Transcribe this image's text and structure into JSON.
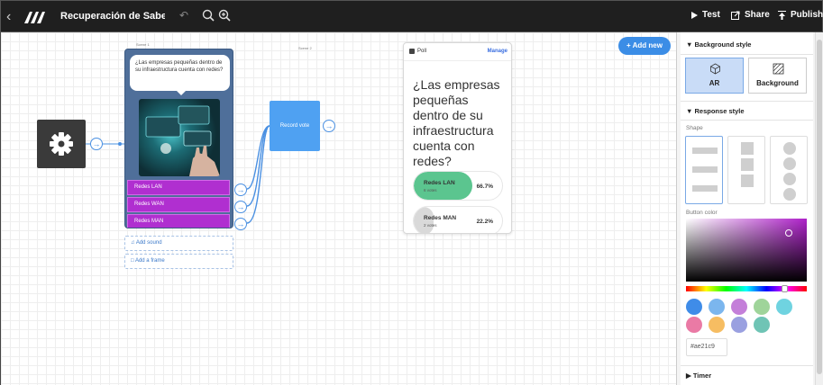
{
  "topbar": {
    "project_title": "Recuperación de Saberes Pı",
    "test_label": "Test",
    "share_label": "Share",
    "publish_label": "Publish"
  },
  "canvas": {
    "scene_1_label": "Scene 1",
    "scene_2_label": "Scene 2",
    "question_bubble": "¿Las empresas pequeñas dentro de su infraestructura cuenta con redes?",
    "choices": [
      "Redes LAN",
      "Redes WAN",
      "Redes MAN"
    ],
    "add_sound_label": "Add sound",
    "add_frame_label": "Add a frame",
    "record_vote_label": "Record vote",
    "add_new_label": "Add new"
  },
  "poll": {
    "title": "Poll",
    "manage_label": "Manage",
    "question": "¿Las empresas pequeñas dentro de su infraestructura cuenta con redes?",
    "options": [
      {
        "name": "Redes LAN",
        "votes": "6 votes",
        "percent_label": "66.7%",
        "percent": 66.7,
        "color": "#5bc58f"
      },
      {
        "name": "Redes MAN",
        "votes": "2 votes",
        "percent_label": "22.2%",
        "percent": 22.2,
        "color": "#d9d9d9"
      }
    ]
  },
  "panel": {
    "background_style_label": "Background style",
    "bg_options": [
      {
        "label": "AR",
        "icon": "ar-cube-icon",
        "selected": true
      },
      {
        "label": "Background",
        "icon": "image-pattern-icon",
        "selected": false
      }
    ],
    "response_style_label": "Response style",
    "shape_label": "Shape",
    "button_color_label": "Button color",
    "hex_value": "#ae21c9",
    "swatches": [
      "#3f8ce8",
      "#7bb6ee",
      "#c47fd9",
      "#9fd49a",
      "#6fd3e0",
      "#ea7aa5",
      "#f6bd62",
      "#9aa0e0",
      "#6fc4b5"
    ],
    "timer_label": "Timer"
  },
  "colors": {
    "topbar_bg": "#1f1f1f",
    "accent_blue": "#3b8de6",
    "choice_purple": "#b02fd0",
    "record_node": "#4fa1f2"
  }
}
